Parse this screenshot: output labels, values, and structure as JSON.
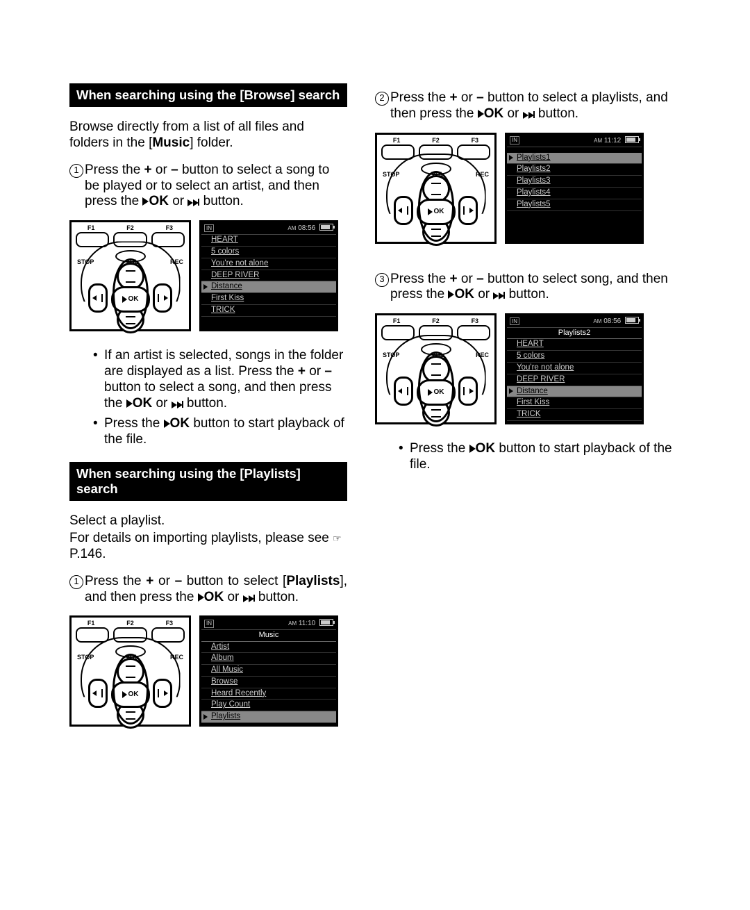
{
  "device_labels": {
    "f1": "F1",
    "f2": "F2",
    "f3": "F3",
    "stop": "STOP",
    "vol": "VOL",
    "rec": "REC",
    "ok": "OK"
  },
  "left": {
    "browse_heading": "When searching using the [Browse] search",
    "browse_intro_a": "Browse directly from a list of all files and folders in the [",
    "browse_intro_music": "Music",
    "browse_intro_b": "] folder.",
    "step1_a": "Press the ",
    "plus": "+",
    "or": " or ",
    "minus": "–",
    "step1_b": " button to select a song to be played or to select an artist, and then press the ",
    "ok": "OK",
    "or2": " or ",
    "step1_c": " button.",
    "bullet1_a": "If an artist is selected, songs in the folder are displayed as a list. Press the ",
    "bullet1_b": " button to select a song, and then press the ",
    "bullet1_c": " button.",
    "bullet2_a": "Press the ",
    "bullet2_b": " button to start playback of the file.",
    "playlists_heading": "When searching using the [Playlists] search",
    "playlists_intro1": "Select a playlist.",
    "playlists_intro2a": "For details on importing playlists, please see ",
    "playlists_intro2b": "P.146.",
    "pl_step1_a": "Press the ",
    "pl_step1_b": " button to select [",
    "pl_bold_playlists": "Playlists",
    "pl_step1_c": "], and then press the ",
    "pl_step1_d": " button."
  },
  "right": {
    "step2_a": "Press the ",
    "step2_b": " button to select a playlists, and then press the ",
    "step2_c": " button.",
    "step3_a": "Press the ",
    "step3_b": " button to select song, and then press the ",
    "step3_c": " button.",
    "bullet_a": "Press the ",
    "bullet_b": " button to start playback of the file."
  },
  "screens": {
    "browse": {
      "time": "08:56",
      "ampm": "AM",
      "items": [
        "HEART",
        "5 colors",
        "You're not alone",
        "DEEP RIVER",
        "Distance",
        "First Kiss",
        "TRICK"
      ],
      "selected_index": 4
    },
    "music_menu": {
      "time": "11:10",
      "ampm": "AM",
      "title": "Music",
      "items": [
        "Artist",
        "Album",
        "All Music",
        "Browse",
        "Heard Recently",
        "Play Count",
        "Playlists"
      ],
      "selected_index": 6
    },
    "playlists_list": {
      "time": "11:12",
      "ampm": "AM",
      "items": [
        "Playlists1",
        "Playlists2",
        "Playlists3",
        "Playlists4",
        "Playlists5"
      ],
      "selected_index": 0
    },
    "playlist_songs": {
      "time": "08:56",
      "ampm": "AM",
      "title": "Playlists2",
      "items": [
        "HEART",
        "5 colors",
        "You're not alone",
        "DEEP RIVER",
        "Distance",
        "First Kiss",
        "TRICK"
      ],
      "selected_index": 4
    }
  }
}
